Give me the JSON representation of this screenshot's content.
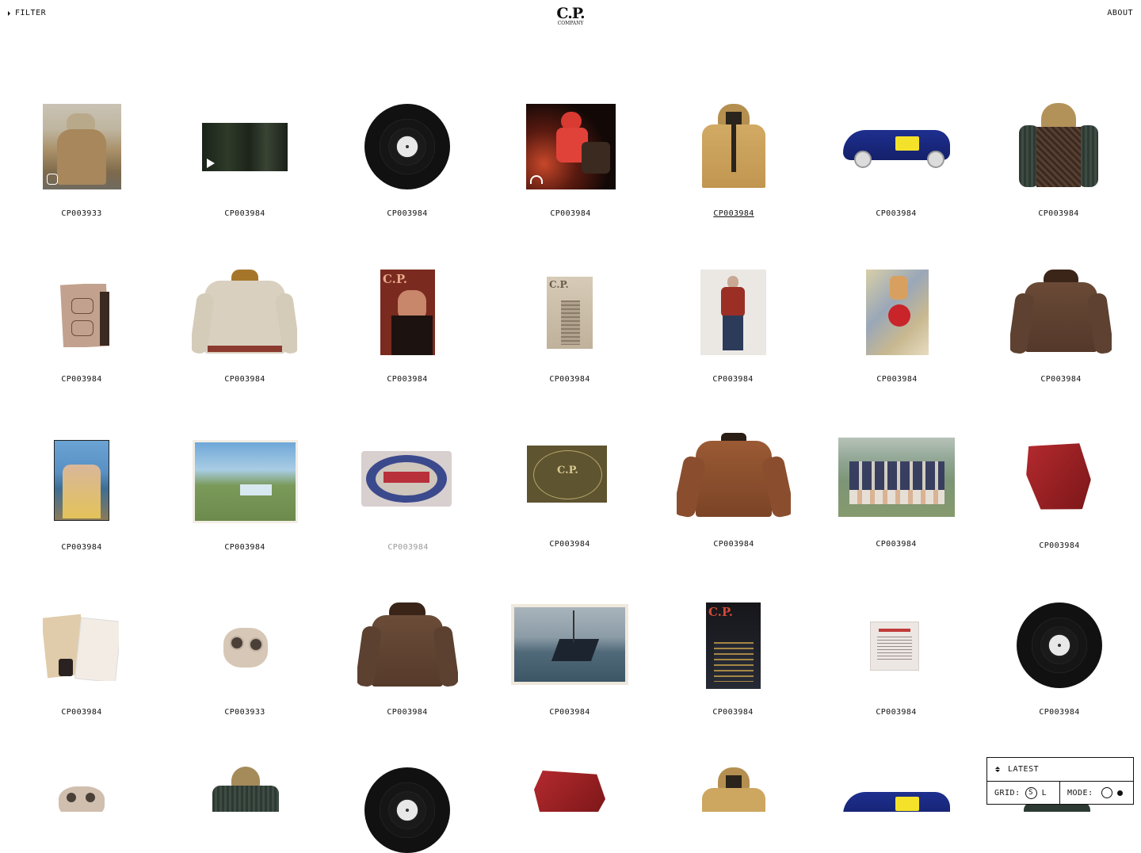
{
  "header": {
    "filter_label": "FILTER",
    "logo_top": "C.P.",
    "logo_bottom": "COMPANY",
    "about_label": "ABOUT"
  },
  "items": [
    {
      "code": "CP003933",
      "icon": "instagram-icon"
    },
    {
      "code": "CP003984",
      "icon": "play-icon"
    },
    {
      "code": "CP003984",
      "icon": "vinyl-record"
    },
    {
      "code": "CP003984",
      "icon": "headphones-icon"
    },
    {
      "code": "CP003984",
      "state": "hover"
    },
    {
      "code": "CP003984"
    },
    {
      "code": "CP003984"
    },
    {
      "code": "CP003984"
    },
    {
      "code": "CP003984"
    },
    {
      "code": "CP003984"
    },
    {
      "code": "CP003984"
    },
    {
      "code": "CP003984"
    },
    {
      "code": "CP003984"
    },
    {
      "code": "CP003984"
    },
    {
      "code": "CP003984"
    },
    {
      "code": "CP003984"
    },
    {
      "code": "CP003984",
      "state": "dimmed"
    },
    {
      "code": "CP003984"
    },
    {
      "code": "CP003984"
    },
    {
      "code": "CP003984"
    },
    {
      "code": "CP003984"
    },
    {
      "code": "CP003984"
    },
    {
      "code": "CP003933"
    },
    {
      "code": "CP003984"
    },
    {
      "code": "CP003984"
    },
    {
      "code": "CP003984"
    },
    {
      "code": "CP003984"
    },
    {
      "code": "CP003984",
      "icon": "vinyl-record"
    }
  ],
  "controls": {
    "sort_label": "LATEST",
    "grid_label": "GRID:",
    "grid_size_s": "S",
    "grid_size_l": "L",
    "mode_label": "MODE:"
  },
  "colors": {
    "background": "#ffffff",
    "text": "#111111",
    "dimmed_text": "#999999"
  }
}
